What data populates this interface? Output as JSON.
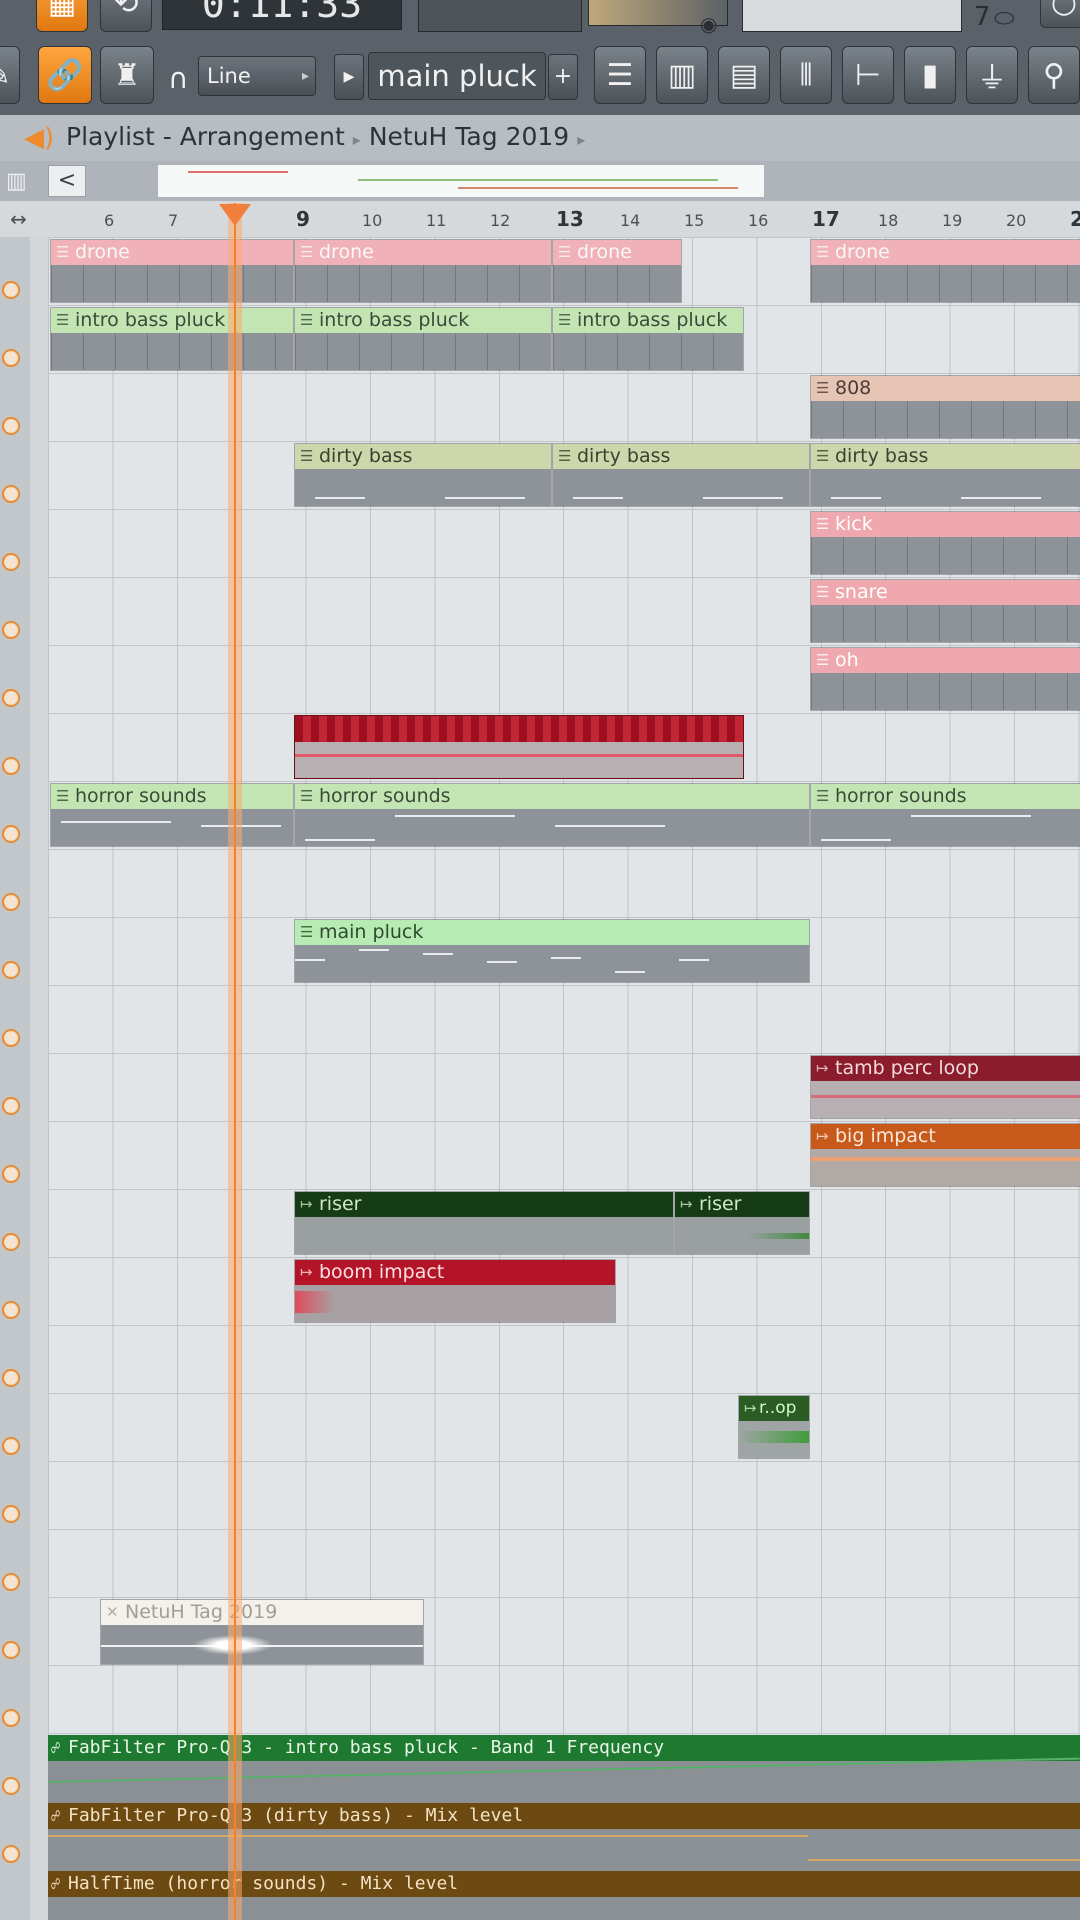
{
  "toolbar": {
    "time": "0:11:33",
    "snap_mode": "Line",
    "pattern_name": "main pluck",
    "counter": "7"
  },
  "window": {
    "title": "Playlist - Arrangement",
    "project": "NetuH Tag 2019"
  },
  "ruler": {
    "ticks": [
      "6",
      "7",
      "9",
      "10",
      "11",
      "12",
      "13",
      "14",
      "15",
      "16",
      "17",
      "18",
      "19",
      "20",
      "2"
    ]
  },
  "clips": {
    "drone1": "drone",
    "drone2": "drone",
    "drone3": "drone",
    "drone4": "drone",
    "ibp1": "intro bass pluck",
    "ibp2": "intro bass pluck",
    "ibp3": "intro bass pluck",
    "c808": "808",
    "dirty1": "dirty bass",
    "dirty2": "dirty bass",
    "dirty3": "dirty bass",
    "kick": "kick",
    "snare": "snare",
    "oh": "oh",
    "horror1": "horror sounds",
    "horror2": "horror sounds",
    "horror3": "horror sounds",
    "main_pluck": "main pluck",
    "tamb": "tamb perc loop",
    "big_impact": "big impact",
    "riser1": "riser",
    "riser2": "riser",
    "boom": "boom impact",
    "rop": "r..op",
    "netuh": "NetuH Tag 2019"
  },
  "automation": {
    "a1": "FabFilter Pro-Q 3 - intro bass pluck - Band 1 Frequency",
    "a2": "FabFilter Pro-Q 3 (dirty bass) - Mix level",
    "a3": "HalfTime (horror sounds) - Mix level"
  },
  "colors": {
    "accent": "#f08a2c",
    "drone": "#f0b2b8",
    "horror": "#c3e5b3"
  }
}
